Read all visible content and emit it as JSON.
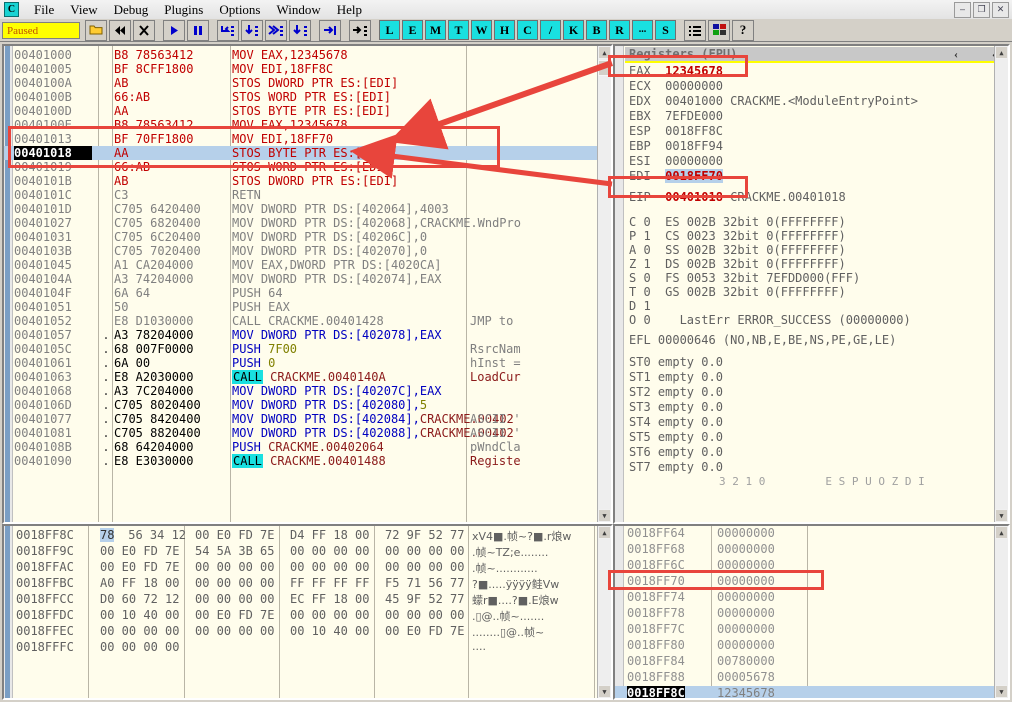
{
  "window": {
    "app_icon_letter": "C",
    "minimize": "–",
    "maximize": "❐",
    "close": "✕"
  },
  "menu": {
    "items": [
      "File",
      "View",
      "Debug",
      "Plugins",
      "Options",
      "Window",
      "Help"
    ]
  },
  "toolbar": {
    "status": "Paused",
    "buttons": [
      "open-icon",
      "rewind-icon",
      "close-x-icon",
      "run-icon",
      "pause-icon",
      "step-over-icon",
      "step-into-icon",
      "trace-into-icon",
      "trace-over-icon",
      "execute-till-return-icon",
      "animate-icon"
    ],
    "letters": [
      "L",
      "E",
      "M",
      "T",
      "W",
      "H",
      "C",
      "/",
      "K",
      "B",
      "R",
      "...",
      "S"
    ],
    "right_icons": [
      "list-icon",
      "appearance-icon",
      "help-icon"
    ]
  },
  "disassembly": {
    "rows": [
      {
        "addr": "00401000",
        "mark": "",
        "bytes": "B8 78563412",
        "mnem": "MOV EAX,12345678",
        "cmt": "",
        "style": "red",
        "cur": false,
        "sel": false
      },
      {
        "addr": "00401005",
        "mark": "",
        "bytes": "BF 8CFF1800",
        "mnem": "MOV EDI,18FF8C",
        "cmt": "",
        "style": "red",
        "cur": false,
        "sel": false
      },
      {
        "addr": "0040100A",
        "mark": "",
        "bytes": "AB",
        "mnem": "STOS DWORD PTR ES:[EDI]",
        "cmt": "",
        "style": "red",
        "cur": false,
        "sel": false
      },
      {
        "addr": "0040100B",
        "mark": "",
        "bytes": "66:AB",
        "mnem": "STOS WORD PTR ES:[EDI]",
        "cmt": "",
        "style": "red",
        "cur": false,
        "sel": false
      },
      {
        "addr": "0040100D",
        "mark": "",
        "bytes": "AA",
        "mnem": "STOS BYTE PTR ES:[EDI]",
        "cmt": "",
        "style": "red",
        "cur": false,
        "sel": false
      },
      {
        "addr": "0040100E",
        "mark": "",
        "bytes": "B8 78563412",
        "mnem": "MOV EAX,12345678",
        "cmt": "",
        "style": "red",
        "cur": false,
        "sel": false
      },
      {
        "addr": "00401013",
        "mark": "",
        "bytes": "BF 70FF1800",
        "mnem": "MOV EDI,18FF70",
        "cmt": "",
        "style": "red",
        "cur": false,
        "sel": false
      },
      {
        "addr": "00401018",
        "mark": "",
        "bytes": "AA",
        "mnem": "STOS BYTE PTR ES:[EDI]",
        "cmt": "",
        "style": "red",
        "cur": true,
        "sel": true
      },
      {
        "addr": "00401019",
        "mark": "",
        "bytes": "66:AB",
        "mnem": "STOS WORD PTR ES:[EDI]",
        "cmt": "",
        "style": "red",
        "cur": false,
        "sel": false
      },
      {
        "addr": "0040101B",
        "mark": "",
        "bytes": "AB",
        "mnem": "STOS DWORD PTR ES:[EDI]",
        "cmt": "",
        "style": "red",
        "cur": false,
        "sel": false
      },
      {
        "addr": "0040101C",
        "mark": "",
        "bytes": "C3",
        "mnem": "RETN",
        "cmt": "",
        "style": "gray",
        "cur": false,
        "sel": false
      },
      {
        "addr": "0040101D",
        "mark": "",
        "bytes": "C705 6420400",
        "mnem": "MOV DWORD PTR DS:[402064],4003",
        "cmt": "",
        "style": "gray",
        "cur": false,
        "sel": false
      },
      {
        "addr": "00401027",
        "mark": "",
        "bytes": "C705 6820400",
        "mnem": "MOV DWORD PTR DS:[402068],CRACKME.WndPro",
        "cmt": "",
        "style": "gray",
        "cur": false,
        "sel": false
      },
      {
        "addr": "00401031",
        "mark": "",
        "bytes": "C705 6C20400",
        "mnem": "MOV DWORD PTR DS:[40206C],0",
        "cmt": "",
        "style": "gray",
        "cur": false,
        "sel": false
      },
      {
        "addr": "0040103B",
        "mark": "",
        "bytes": "C705 7020400",
        "mnem": "MOV DWORD PTR DS:[402070],0",
        "cmt": "",
        "style": "gray",
        "cur": false,
        "sel": false
      },
      {
        "addr": "00401045",
        "mark": "",
        "bytes": "A1 CA204000",
        "mnem": "MOV EAX,DWORD PTR DS:[4020CA]",
        "cmt": "",
        "style": "gray",
        "cur": false,
        "sel": false
      },
      {
        "addr": "0040104A",
        "mark": "",
        "bytes": "A3 74204000",
        "mnem": "MOV DWORD PTR DS:[402074],EAX",
        "cmt": "",
        "style": "gray",
        "cur": false,
        "sel": false
      },
      {
        "addr": "0040104F",
        "mark": "",
        "bytes": "6A 64",
        "mnem": "PUSH 64",
        "cmt": "",
        "style": "gray",
        "cur": false,
        "sel": false
      },
      {
        "addr": "00401051",
        "mark": "",
        "bytes": "50",
        "mnem": "PUSH EAX",
        "cmt": "",
        "style": "gray",
        "cur": false,
        "sel": false
      },
      {
        "addr": "00401052",
        "mark": "",
        "bytes": "E8 D1030000",
        "mnem": "CALL CRACKME.00401428",
        "cmt": "JMP to",
        "style": "gray",
        "cur": false,
        "sel": false
      },
      {
        "addr": "00401057",
        "mark": ".",
        "bytes": "A3 78204000",
        "mnem": "MOV DWORD PTR DS:[402078],EAX",
        "cmt": "",
        "style": "blue",
        "cur": false,
        "sel": false
      },
      {
        "addr": "0040105C",
        "mark": ".",
        "bytes": "68 007F0000",
        "mnem": "PUSH 7F00",
        "cmt": "RsrcNam",
        "style": "blue",
        "cur": false,
        "sel": false
      },
      {
        "addr": "00401061",
        "mark": ".",
        "bytes": "6A 00",
        "mnem": "PUSH 0",
        "cmt": "hInst =",
        "style": "blue",
        "cur": false,
        "sel": false
      },
      {
        "addr": "00401063",
        "mark": ".",
        "bytes": "E8 A2030000",
        "mnem": "CALL CRACKME.0040140A",
        "cmt": "LoadCur",
        "style": "call",
        "cur": false,
        "sel": false
      },
      {
        "addr": "00401068",
        "mark": ".",
        "bytes": "A3 7C204000",
        "mnem": "MOV DWORD PTR DS:[40207C],EAX",
        "cmt": "",
        "style": "blue",
        "cur": false,
        "sel": false
      },
      {
        "addr": "0040106D",
        "mark": ".",
        "bytes": "C705 8020400",
        "mnem": "MOV DWORD PTR DS:[402080],5",
        "cmt": "",
        "style": "blue",
        "cur": false,
        "sel": false
      },
      {
        "addr": "00401077",
        "mark": ".",
        "bytes": "C705 8420400",
        "mnem": "MOV DWORD PTR DS:[402084],CRACKME.00402",
        "cmt": "ASCII '",
        "style": "blue",
        "cur": false,
        "sel": false
      },
      {
        "addr": "00401081",
        "mark": ".",
        "bytes": "C705 8820400",
        "mnem": "MOV DWORD PTR DS:[402088],CRACKME.00402",
        "cmt": "ASCII '",
        "style": "blue",
        "cur": false,
        "sel": false
      },
      {
        "addr": "0040108B",
        "mark": ".",
        "bytes": "68 64204000",
        "mnem": "PUSH CRACKME.00402064",
        "cmt": "pWndCla",
        "style": "blue",
        "cur": false,
        "sel": false
      },
      {
        "addr": "00401090",
        "mark": ".",
        "bytes": "E8 E3030000",
        "mnem": "CALL CRACKME.00401488",
        "cmt": "Registe",
        "style": "call",
        "cur": false,
        "sel": false
      }
    ]
  },
  "registers": {
    "title": "Registers (FPU)",
    "chevrons": [
      "‹",
      "‹"
    ],
    "general": [
      {
        "name": "EAX",
        "value": "12345678",
        "comment": "",
        "changed": true,
        "selected": false
      },
      {
        "name": "ECX",
        "value": "00000000",
        "comment": "",
        "changed": false,
        "selected": false
      },
      {
        "name": "EDX",
        "value": "00401000",
        "comment": "CRACKME.<ModuleEntryPoint>",
        "changed": false,
        "selected": false
      },
      {
        "name": "EBX",
        "value": "7EFDE000",
        "comment": "",
        "changed": false,
        "selected": false
      },
      {
        "name": "ESP",
        "value": "0018FF8C",
        "comment": "",
        "changed": false,
        "selected": false
      },
      {
        "name": "EBP",
        "value": "0018FF94",
        "comment": "",
        "changed": false,
        "selected": false
      },
      {
        "name": "ESI",
        "value": "00000000",
        "comment": "",
        "changed": false,
        "selected": false
      },
      {
        "name": "EDI",
        "value": "0018FF70",
        "comment": "",
        "changed": true,
        "selected": true
      }
    ],
    "eip": {
      "name": "EIP",
      "value": "00401018",
      "comment": "CRACKME.00401018"
    },
    "flags": [
      {
        "flag": "C",
        "bit": "0",
        "seg": "ES",
        "sel": "002B",
        "desc": "32bit 0(FFFFFFFF)"
      },
      {
        "flag": "P",
        "bit": "1",
        "seg": "CS",
        "sel": "0023",
        "desc": "32bit 0(FFFFFFFF)"
      },
      {
        "flag": "A",
        "bit": "0",
        "seg": "SS",
        "sel": "002B",
        "desc": "32bit 0(FFFFFFFF)"
      },
      {
        "flag": "Z",
        "bit": "1",
        "seg": "DS",
        "sel": "002B",
        "desc": "32bit 0(FFFFFFFF)"
      },
      {
        "flag": "S",
        "bit": "0",
        "seg": "FS",
        "sel": "0053",
        "desc": "32bit 7EFDD000(FFF)"
      },
      {
        "flag": "T",
        "bit": "0",
        "seg": "GS",
        "sel": "002B",
        "desc": "32bit 0(FFFFFFFF)"
      },
      {
        "flag": "D",
        "bit": "1",
        "seg": "",
        "sel": "",
        "desc": ""
      },
      {
        "flag": "O",
        "bit": "0",
        "seg": "",
        "sel": "",
        "desc": "LastErr ERROR_SUCCESS (00000000)"
      }
    ],
    "efl": "EFL 00000646 (NO,NB,E,BE,NS,PE,GE,LE)",
    "fpu": [
      {
        "name": "ST0",
        "state": "empty",
        "value": "0.0"
      },
      {
        "name": "ST1",
        "state": "empty",
        "value": "0.0"
      },
      {
        "name": "ST2",
        "state": "empty",
        "value": "0.0"
      },
      {
        "name": "ST3",
        "state": "empty",
        "value": "0.0"
      },
      {
        "name": "ST4",
        "state": "empty",
        "value": "0.0"
      },
      {
        "name": "ST5",
        "state": "empty",
        "value": "0.0"
      },
      {
        "name": "ST6",
        "state": "empty",
        "value": "0.0"
      },
      {
        "name": "ST7",
        "state": "empty",
        "value": "0.0"
      }
    ],
    "fpu_footer_left": "3 2 1 0",
    "fpu_footer_right": "E S P U O Z D I"
  },
  "dump": {
    "rows": [
      {
        "addr": "0018FF8C",
        "g1": "78 56 34 12",
        "g2": "00 E0 FD 7E",
        "g3": "D4 FF 18 00",
        "g4": "72 9F 52 77",
        "ascii": "xV4■.帧~?■.r烺w",
        "first_hl": true
      },
      {
        "addr": "0018FF9C",
        "g1": "00 E0 FD 7E",
        "g2": "54 5A 3B 65",
        "g3": "00 00 00 00",
        "g4": "00 00 00 00",
        "ascii": ".帧~TZ;e........",
        "first_hl": false
      },
      {
        "addr": "0018FFAC",
        "g1": "00 E0 FD 7E",
        "g2": "00 00 00 00",
        "g3": "00 00 00 00",
        "g4": "00 00 00 00",
        "ascii": ".帧~............",
        "first_hl": false
      },
      {
        "addr": "0018FFBC",
        "g1": "A0 FF 18 00",
        "g2": "00 00 00 00",
        "g3": "FF FF FF FF",
        "g4": "F5 71 56 77",
        "ascii": "?■.....ÿÿÿÿ鲑Vw",
        "first_hl": false
      },
      {
        "addr": "0018FFCC",
        "g1": "D0 60 72 12",
        "g2": "00 00 00 00",
        "g3": "EC FF 18 00",
        "g4": "45 9F 52 77",
        "ascii": "蠓r■....?■.E烺w",
        "first_hl": false
      },
      {
        "addr": "0018FFDC",
        "g1": "00 10 40 00",
        "g2": "00 E0 FD 7E",
        "g3": "00 00 00 00",
        "g4": "00 00 00 00",
        "ascii": ".▯@..帧~.......",
        "first_hl": false
      },
      {
        "addr": "0018FFEC",
        "g1": "00 00 00 00",
        "g2": "00 00 00 00",
        "g3": "00 10 40 00",
        "g4": "00 E0 FD 7E",
        "ascii": "........▯@..帧~",
        "first_hl": false
      },
      {
        "addr": "0018FFFC",
        "g1": "00 00 00 00",
        "g2": "",
        "g3": "",
        "g4": "",
        "ascii": "....",
        "first_hl": false
      }
    ]
  },
  "stack": {
    "rows": [
      {
        "addr": "0018FF64",
        "value": "00000000",
        "current": false
      },
      {
        "addr": "0018FF68",
        "value": "00000000",
        "current": false
      },
      {
        "addr": "0018FF6C",
        "value": "00000000",
        "current": false
      },
      {
        "addr": "0018FF70",
        "value": "00000000",
        "current": false
      },
      {
        "addr": "0018FF74",
        "value": "00000000",
        "current": false
      },
      {
        "addr": "0018FF78",
        "value": "00000000",
        "current": false
      },
      {
        "addr": "0018FF7C",
        "value": "00000000",
        "current": false
      },
      {
        "addr": "0018FF80",
        "value": "00000000",
        "current": false
      },
      {
        "addr": "0018FF84",
        "value": "00780000",
        "current": false
      },
      {
        "addr": "0018FF88",
        "value": "00005678",
        "current": false
      },
      {
        "addr": "0018FF8C",
        "value": "12345678",
        "current": true
      }
    ]
  },
  "annotations": {
    "accent_color": "#e8453c",
    "boxes": [
      {
        "name": "disasm-highlight-box"
      },
      {
        "name": "eax-register-box"
      },
      {
        "name": "edi-register-box"
      },
      {
        "name": "stack-ff70-box"
      }
    ],
    "arrows": [
      {
        "name": "arrow-eax-to-disasm"
      },
      {
        "name": "arrow-edi-to-disasm"
      }
    ]
  }
}
